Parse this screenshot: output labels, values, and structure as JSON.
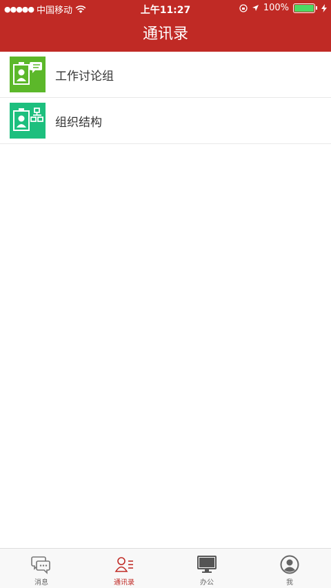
{
  "status_bar": {
    "signal": "●●●●●",
    "carrier": "中国移动",
    "wifi_icon": "wifi-icon",
    "time": "上午11:27",
    "battery_percent": "100%"
  },
  "nav": {
    "title": "通讯录"
  },
  "list": [
    {
      "label": "工作讨论组",
      "icon": "group-chat-icon",
      "color": "#5cb82a"
    },
    {
      "label": "组织结构",
      "icon": "org-structure-icon",
      "color": "#1dbf7e"
    }
  ],
  "tabs": [
    {
      "label": "消息",
      "icon": "chat-icon",
      "active": false
    },
    {
      "label": "通讯录",
      "icon": "contacts-icon",
      "active": true
    },
    {
      "label": "办公",
      "icon": "monitor-icon",
      "active": false
    },
    {
      "label": "我",
      "icon": "profile-icon",
      "active": false
    }
  ],
  "colors": {
    "brand": "#c02a25",
    "tab_active": "#c02a25",
    "tab_inactive": "#888888"
  }
}
